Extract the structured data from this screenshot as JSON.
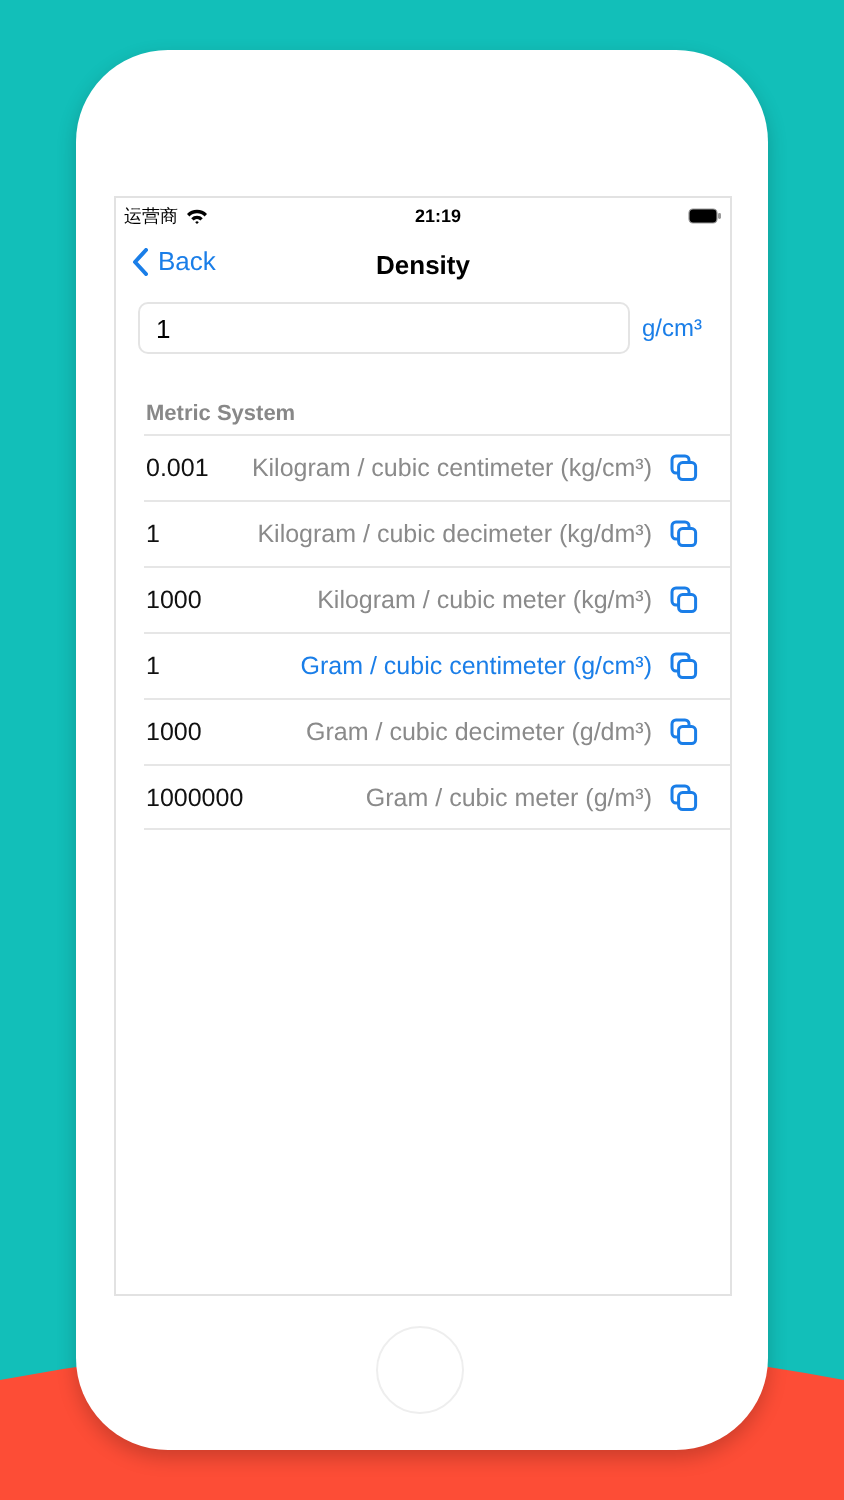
{
  "status_bar": {
    "carrier": "运营商",
    "time": "21:19"
  },
  "nav": {
    "back": "Back",
    "title": "Density"
  },
  "input": {
    "value": "1",
    "unit": "g/cm³"
  },
  "section": {
    "title": "Metric System",
    "rows": [
      {
        "value": "0.001",
        "unit": "Kilogram / cubic centimeter (kg/cm³)",
        "selected": false
      },
      {
        "value": "1",
        "unit": "Kilogram / cubic decimeter (kg/dm³)",
        "selected": false
      },
      {
        "value": "1000",
        "unit": "Kilogram / cubic meter (kg/m³)",
        "selected": false
      },
      {
        "value": "1",
        "unit": "Gram / cubic centimeter (g/cm³)",
        "selected": true
      },
      {
        "value": "1000",
        "unit": "Gram / cubic decimeter (g/dm³)",
        "selected": false
      },
      {
        "value": "1000000",
        "unit": "Gram / cubic meter (g/m³)",
        "selected": false
      }
    ]
  }
}
